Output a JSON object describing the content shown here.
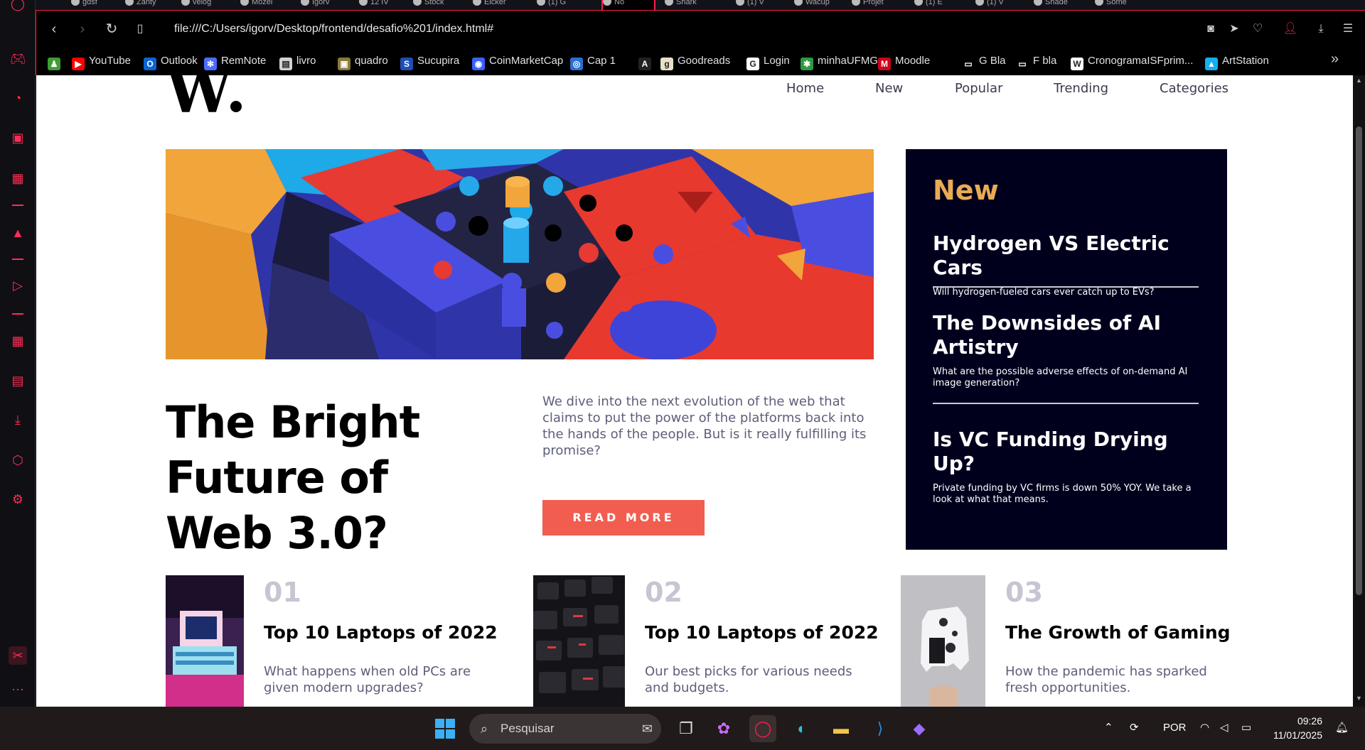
{
  "tabs": [
    {
      "label": "gdsf"
    },
    {
      "label": "Zanty"
    },
    {
      "label": "velog"
    },
    {
      "label": "Mozel"
    },
    {
      "label": "Igorv"
    },
    {
      "label": "12 IV"
    },
    {
      "label": "Stock"
    },
    {
      "label": "Elcker"
    },
    {
      "label": "(1) G"
    },
    {
      "label": "No"
    },
    {
      "label": "Shark"
    },
    {
      "label": "(1) V"
    },
    {
      "label": "Wacup"
    },
    {
      "label": "Projet"
    },
    {
      "label": "(1) E"
    },
    {
      "label": "(1) V"
    },
    {
      "label": "Shade"
    },
    {
      "label": "Some"
    }
  ],
  "toolbar": {
    "url": "file:///C:/Users/igorv/Desktop/frontend/desafio%201/index.html#"
  },
  "bookmarks": [
    {
      "label": "",
      "color": "#3f9d34",
      "glyph": "♟"
    },
    {
      "label": "YouTube",
      "color": "#ff0000",
      "glyph": "▶"
    },
    {
      "label": "Outlook",
      "color": "#0a64d6",
      "glyph": "O"
    },
    {
      "label": "RemNote",
      "color": "#4b6cff",
      "glyph": "✻"
    },
    {
      "label": "livro",
      "color": "#d0d0d6",
      "glyph": "▤"
    },
    {
      "label": "quadro",
      "color": "#8a7a3a",
      "glyph": "▣"
    },
    {
      "label": "Sucupira",
      "color": "#1d4fb3",
      "glyph": "S"
    },
    {
      "label": "CoinMarketCap",
      "color": "#3861fb",
      "glyph": "◉"
    },
    {
      "label": "Cap 1",
      "color": "#2a6fd1",
      "glyph": "◎"
    },
    {
      "label": "",
      "color": "#222",
      "glyph": "A"
    },
    {
      "label": "Goodreads",
      "color": "#e9dfc7",
      "glyph": "g"
    },
    {
      "label": "Login",
      "color": "#ffffff",
      "glyph": "G"
    },
    {
      "label": "minhaUFMG",
      "color": "#2e9b3f",
      "glyph": "✱"
    },
    {
      "label": "Moodle",
      "color": "#d0021b",
      "glyph": "M"
    },
    {
      "label": "G Bla",
      "color": "#000",
      "glyph": "▭"
    },
    {
      "label": "F bla",
      "color": "#000",
      "glyph": "▭"
    },
    {
      "label": "CronogramaISFprim...",
      "color": "#ffffff",
      "glyph": "W"
    },
    {
      "label": "ArtStation",
      "color": "#13aff0",
      "glyph": "▲"
    }
  ],
  "site": {
    "logo": "W",
    "nav": [
      "Home",
      "New",
      "Popular",
      "Trending",
      "Categories"
    ],
    "headline": "The Bright Future of Web 3.0?",
    "lede": "We dive into the next evolution of the web that claims to put the power of the platforms back into the hands of the people. But is it really fulfilling its promise?",
    "read_more": "READ MORE",
    "new_heading": "New",
    "new_items": [
      {
        "title": "Hydrogen VS Electric Cars",
        "sub": "Will hydrogen-fueled cars ever catch up to EVs?"
      },
      {
        "title": "The Downsides of AI Artistry",
        "sub": "What are the possible adverse effects of on-demand AI image generation?"
      },
      {
        "title": "Is VC Funding Drying Up?",
        "sub": "Private funding by VC firms is down 50% YOY. We take a look at what that means."
      }
    ],
    "cards": [
      {
        "num": "01",
        "title": "Top 10 Laptops of 2022",
        "desc": "What happens when old PCs are given modern upgrades?"
      },
      {
        "num": "02",
        "title": "Top 10 Laptops of 2022",
        "desc": "Our best picks for various needs and budgets."
      },
      {
        "num": "03",
        "title": "The Growth of Gaming",
        "desc": "How the pandemic has sparked fresh opportunities."
      }
    ]
  },
  "taskbar": {
    "search_placeholder": "Pesquisar",
    "lang": "POR",
    "time": "09:26",
    "date": "11/01/2025"
  },
  "colors": {
    "accent": "#ff1b4c",
    "read_more": "#f15e50",
    "new_box_bg": "#00001d",
    "new_heading": "#e9ab53"
  }
}
